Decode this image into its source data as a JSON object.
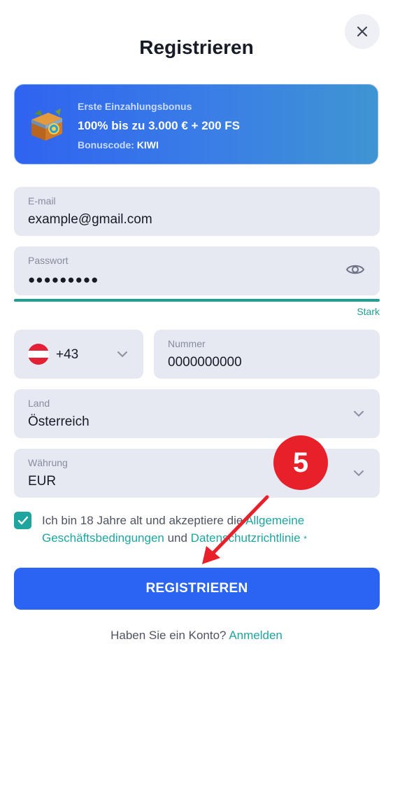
{
  "header": {
    "title": "Registrieren",
    "close_icon": "close-icon"
  },
  "bonus": {
    "subtitle": "Erste Einzahlungsbonus",
    "headline": "100% bis zu 3.000 € + 200 FS",
    "code_label": "Bonuscode:",
    "code_value": "KIWI",
    "icon": "treasure-chest-icon"
  },
  "form": {
    "email": {
      "label": "E-mail",
      "value": "example@gmail.com"
    },
    "password": {
      "label": "Passwort",
      "value": "●●●●●●●●●",
      "strength": "Stark",
      "strength_color": "#1f9e93",
      "toggle_icon": "eye-icon"
    },
    "phone": {
      "country_code": "+43",
      "flag_icon": "austria-flag-icon",
      "number_label": "Nummer",
      "number_value": "0000000000"
    },
    "country": {
      "label": "Land",
      "value": "Österreich"
    },
    "currency": {
      "label": "Währung",
      "value": "EUR"
    },
    "terms": {
      "checked": true,
      "text_before": "Ich bin 18 Jahre alt und akzeptiere die ",
      "link_terms": "Allgemeine Geschäftsbedingungen",
      "text_and": " und ",
      "link_privacy": "Datenschutzrichtlinie",
      "required_mark": "*"
    },
    "submit_label": "REGISTRIEREN"
  },
  "footer": {
    "question": "Haben Sie ein Konto?",
    "login_link": "Anmelden"
  },
  "annotation": {
    "step_number": "5",
    "color": "#e8202a"
  },
  "colors": {
    "accent": "#2b64f3",
    "link": "#1fa4a0",
    "field_bg": "#e6e8f2"
  }
}
